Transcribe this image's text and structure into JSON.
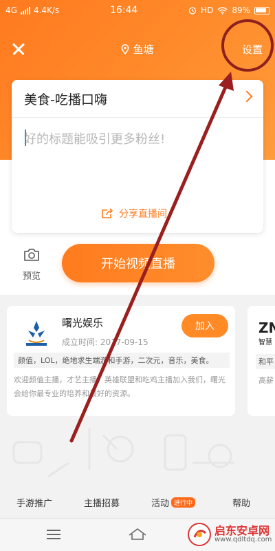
{
  "status_bar": {
    "network": "4G",
    "speed": "4.4K/s",
    "time": "16:44",
    "right_text": "HD",
    "battery": "89%"
  },
  "header": {
    "location": "鱼塘",
    "settings_label": "设置"
  },
  "live_card": {
    "category": "美食-吃播口嗨",
    "title_placeholder": "好的标题能吸引更多粉丝!",
    "share_label": "分享直播间"
  },
  "actions": {
    "preview_label": "预览",
    "start_label": "开始视频直播"
  },
  "guilds": [
    {
      "name": "曙光娱乐",
      "founded": "成立时间: 2017-09-15",
      "join_label": "加入",
      "tags": "颜值，LOL，绝地求生端游和手游，二次元，音乐，美食。",
      "description": "欢迎颜值主播，才艺主播，英雄联盟和吃鸡主播加入我们，曙光会给你最专业的培养和最好的资源。"
    },
    {
      "logo": "ZN",
      "sub": "智慧",
      "tag": "和平",
      "description": "高薪"
    }
  ],
  "tabs": [
    {
      "label": "手游推广"
    },
    {
      "label": "主播招募"
    },
    {
      "label": "活动",
      "badge": "进行中"
    },
    {
      "label": "帮助"
    }
  ],
  "watermark": {
    "title": "启东安卓网",
    "url": "www.qdltdq.com"
  },
  "colors": {
    "brand_orange": "#ff7a1f",
    "annotation_red": "#8e2020"
  }
}
